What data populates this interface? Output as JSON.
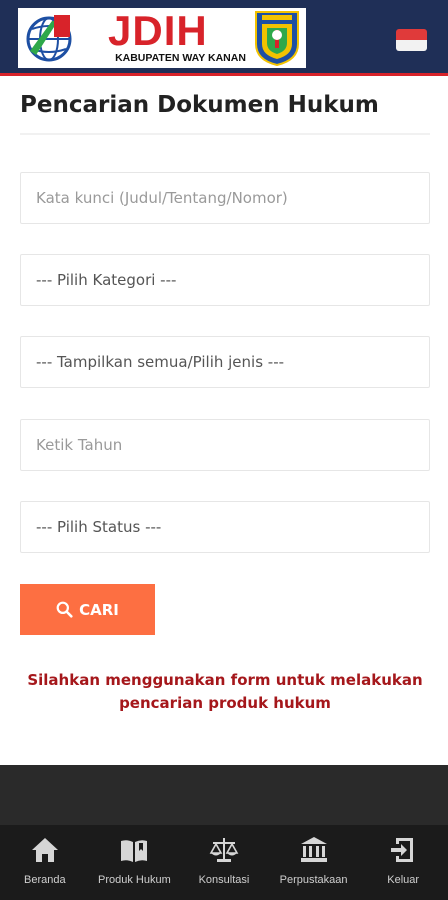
{
  "header": {
    "logo_title": "JDIH",
    "logo_subtitle": "KABUPATEN WAY KANAN",
    "flag_icon": "indonesia-flag-icon",
    "colors": {
      "bar": "#1f2f57",
      "accent": "#d8232a"
    }
  },
  "page": {
    "title": "Pencarian Dokumen Hukum"
  },
  "form": {
    "keyword_placeholder": "Kata kunci (Judul/Tentang/Nomor)",
    "category_selected": "--- Pilih Kategori ---",
    "type_selected": "--- Tampilkan semua/Pilih jenis ---",
    "year_placeholder": "Ketik Tahun",
    "status_selected": "--- Pilih Status ---",
    "search_label": "CARI",
    "search_icon": "search-icon",
    "button_color": "#fd6f42"
  },
  "hint": "Silahkan menggunakan form untuk melakukan pencarian produk hukum",
  "bottom_nav": {
    "items": [
      {
        "label": "Beranda",
        "icon": "home-icon"
      },
      {
        "label": "Produk Hukum",
        "icon": "book-icon"
      },
      {
        "label": "Konsultasi",
        "icon": "scales-icon"
      },
      {
        "label": "Perpustakaan",
        "icon": "library-icon"
      },
      {
        "label": "Keluar",
        "icon": "logout-icon"
      }
    ]
  }
}
